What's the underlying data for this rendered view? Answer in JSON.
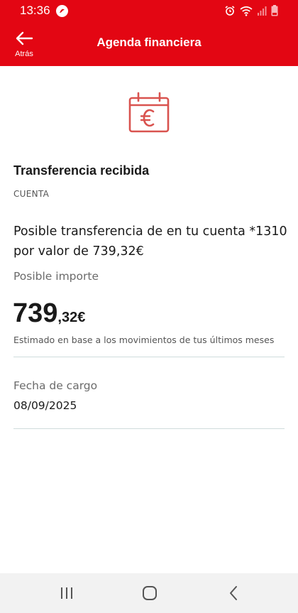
{
  "status_bar": {
    "time": "13:36",
    "icons": [
      "app-notification-icon",
      "alarm-icon",
      "wifi-icon",
      "signal-icon",
      "battery-icon"
    ]
  },
  "header": {
    "back_label": "Atrás",
    "title": "Agenda financiera"
  },
  "content": {
    "icon": "calendar-euro-icon",
    "title": "Transferencia recibida",
    "section_label": "CUENTA",
    "description": "Posible transferencia de  en tu cuenta *1310 por valor de 739,32€",
    "amount_label": "Posible importe",
    "amount_integer": "739",
    "amount_decimal": ",32€",
    "amount_note": "Estimado en base a los movimientos de tus últimos meses",
    "date_label": "Fecha de cargo",
    "date_value": "08/09/2025"
  },
  "nav_bar": {
    "buttons": [
      "recents-icon",
      "home-icon",
      "back-icon"
    ]
  },
  "colors": {
    "brand": "#e30613",
    "icon_accent": "#d9534f",
    "divider": "#cfdcdc",
    "nav_background": "#f2f2f2"
  }
}
